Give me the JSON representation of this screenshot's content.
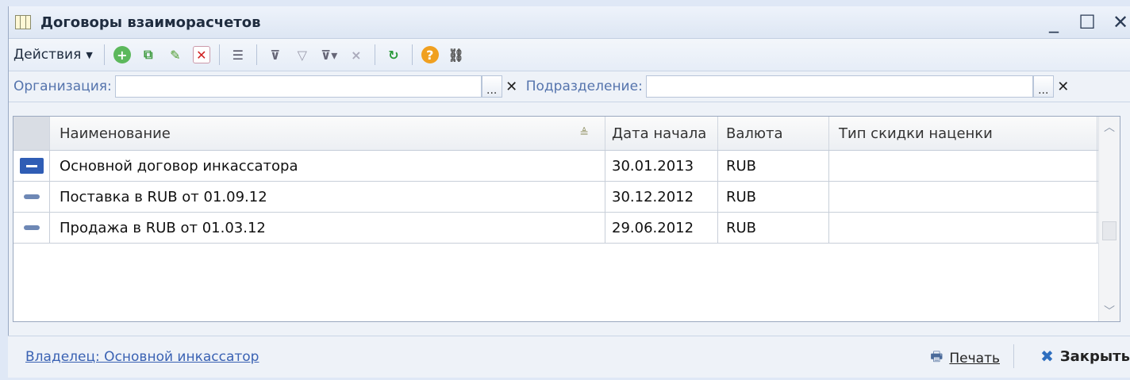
{
  "window": {
    "title": "Договоры взаиморасчетов",
    "controls": {
      "minimize": "_",
      "maximize": "☐",
      "close": "✕"
    }
  },
  "toolbar": {
    "actions_label": "Действия",
    "icons": [
      "add-icon",
      "copy-icon",
      "edit-icon",
      "delete-icon",
      "hierarchy-icon",
      "filter-icon",
      "filter-set-icon",
      "filter-dropdown-icon",
      "filter-clear-icon",
      "refresh-icon",
      "help-icon",
      "link-icon"
    ]
  },
  "filters": {
    "organization_label": "Организация:",
    "organization_value": "",
    "organization_select": "...",
    "organization_clear": "✕",
    "division_label": "Подразделение:",
    "division_value": "",
    "division_select": "...",
    "division_clear": "✕"
  },
  "table": {
    "columns": [
      "Наименование",
      "Дата начала",
      "Валюта",
      "Тип скидки наценки"
    ],
    "rows": [
      {
        "name": "Основной договор инкассатора",
        "start_date": "30.01.2013",
        "currency": "RUB",
        "discount_type": ""
      },
      {
        "name": "Поставка в RUB от 01.09.12",
        "start_date": "30.12.2012",
        "currency": "RUB",
        "discount_type": ""
      },
      {
        "name": "Продажа в RUB от 01.03.12",
        "start_date": "29.06.2012",
        "currency": "RUB",
        "discount_type": ""
      }
    ]
  },
  "footer": {
    "owner_link": "Владелец: Основной инкассатор",
    "print_label": "Печать",
    "close_label": "Закрыть"
  },
  "colors": {
    "link": "#3a62b3",
    "label": "#5574ad",
    "selection": "#2f5db5"
  }
}
